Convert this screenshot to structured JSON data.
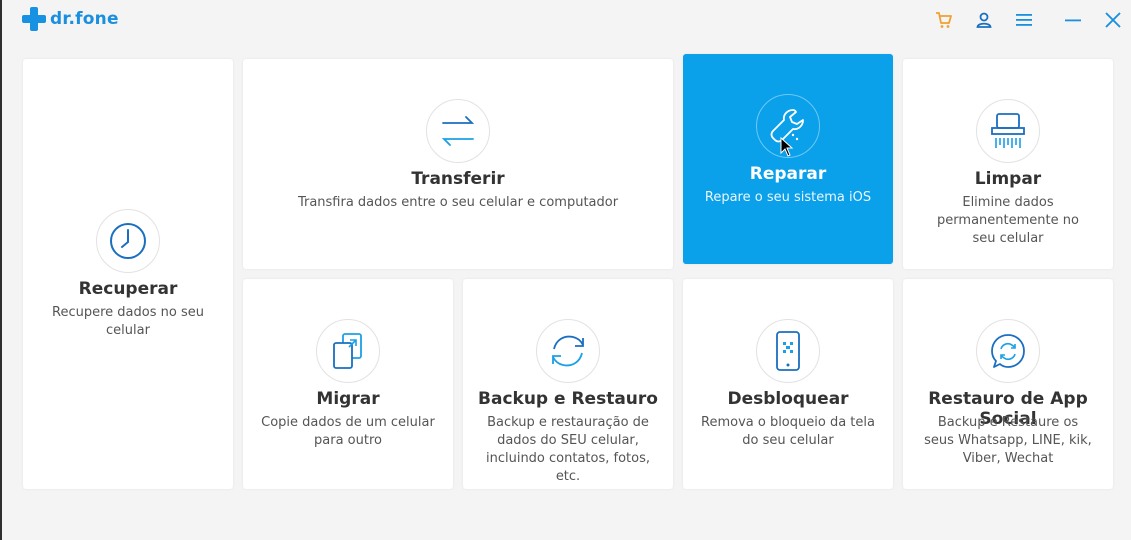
{
  "app": {
    "brand": "dr.fone"
  },
  "header": {
    "icons": [
      "cart-icon",
      "user-icon",
      "menu-icon",
      "minimize-icon",
      "close-icon"
    ],
    "accent_cart": "#f0a030",
    "accent_icons": "#1a8fe0"
  },
  "cards": {
    "recuperar": {
      "title": "Recuperar",
      "desc": "Recupere dados no seu celular"
    },
    "transferir": {
      "title": "Transferir",
      "desc": "Transfira dados entre o seu celular e computador"
    },
    "reparar": {
      "title": "Reparar",
      "desc": "Repare o seu sistema iOS"
    },
    "limpar": {
      "title": "Limpar",
      "desc": "Elimine dados permanentemente no seu celular"
    },
    "migrar": {
      "title": "Migrar",
      "desc": "Copie dados de um celular para outro"
    },
    "backup": {
      "title": "Backup e Restauro",
      "desc": "Backup e restauração de dados do SEU celular, incluindo contatos, fotos, etc."
    },
    "desbloquear": {
      "title": "Desbloquear",
      "desc": "Remova o bloqueio da tela do seu celular"
    },
    "social": {
      "title": "Restauro de App Social",
      "desc": "Backup e Restaure os seus Whatsapp, LINE, kik, Viber, Wechat"
    }
  },
  "colors": {
    "primary": "#0aa0ea",
    "icon_blue": "#1a7fd0",
    "background": "#f4f4f4"
  }
}
